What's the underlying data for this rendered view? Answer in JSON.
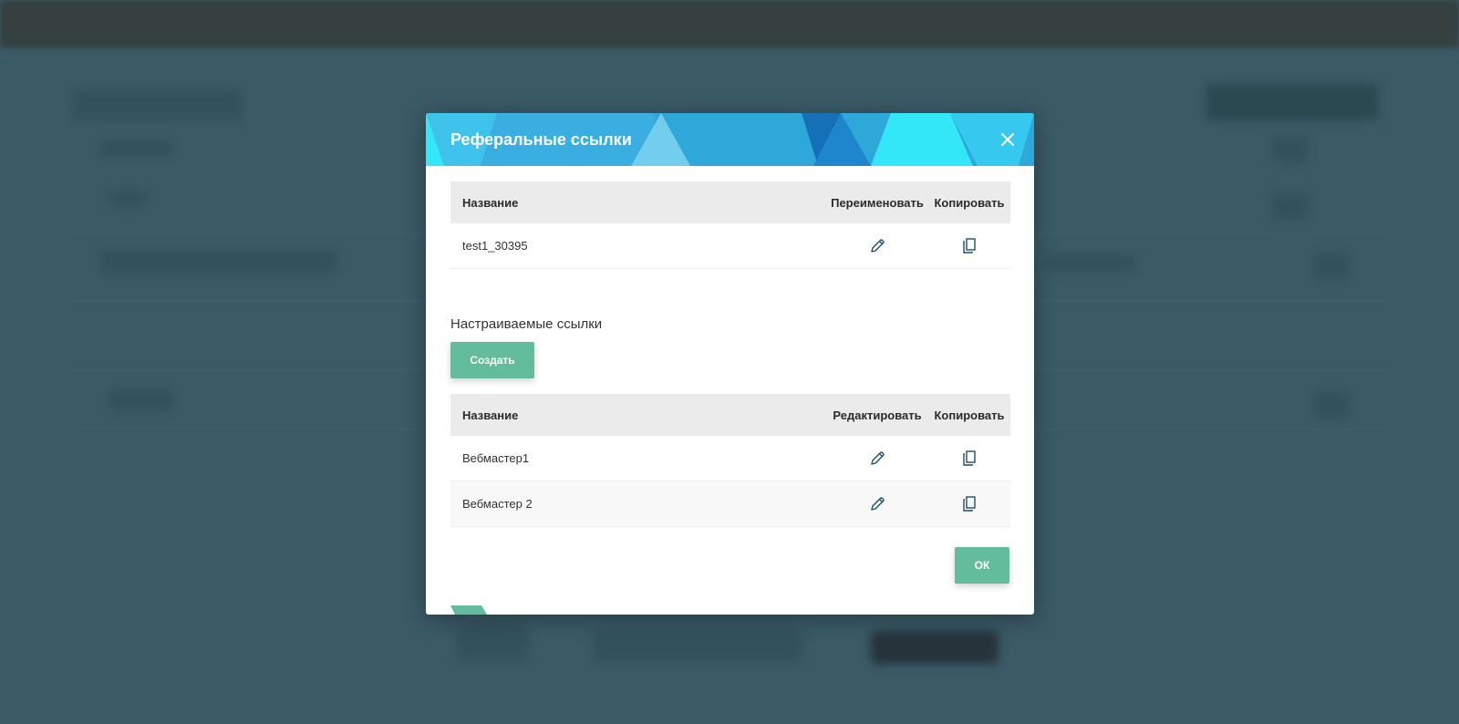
{
  "modal": {
    "title": "Реферальные ссылки",
    "header_colors": [
      "#2ea8d8",
      "#3fc3ec",
      "#33e6f8",
      "#1670b8",
      "#73cdec"
    ]
  },
  "referral_table": {
    "headers": {
      "name": "Название",
      "action": "Переименовать",
      "copy": "Копировать"
    },
    "rows": [
      {
        "name": "test1_30395"
      }
    ]
  },
  "custom_links": {
    "title": "Настраиваемые ссылки",
    "create_label": "Создать",
    "headers": {
      "name": "Название",
      "action": "Редактировать",
      "copy": "Копировать"
    },
    "rows": [
      {
        "name": "Вебмастер1"
      },
      {
        "name": "Вебмастер 2"
      }
    ]
  },
  "footer": {
    "ok_label": "ОК"
  },
  "icons": {
    "close": "close-icon",
    "edit": "pencil-icon",
    "copy": "copy-icon"
  },
  "colors": {
    "accent_green": "#63bc9b",
    "icon_blue": "#1d4f6b"
  }
}
